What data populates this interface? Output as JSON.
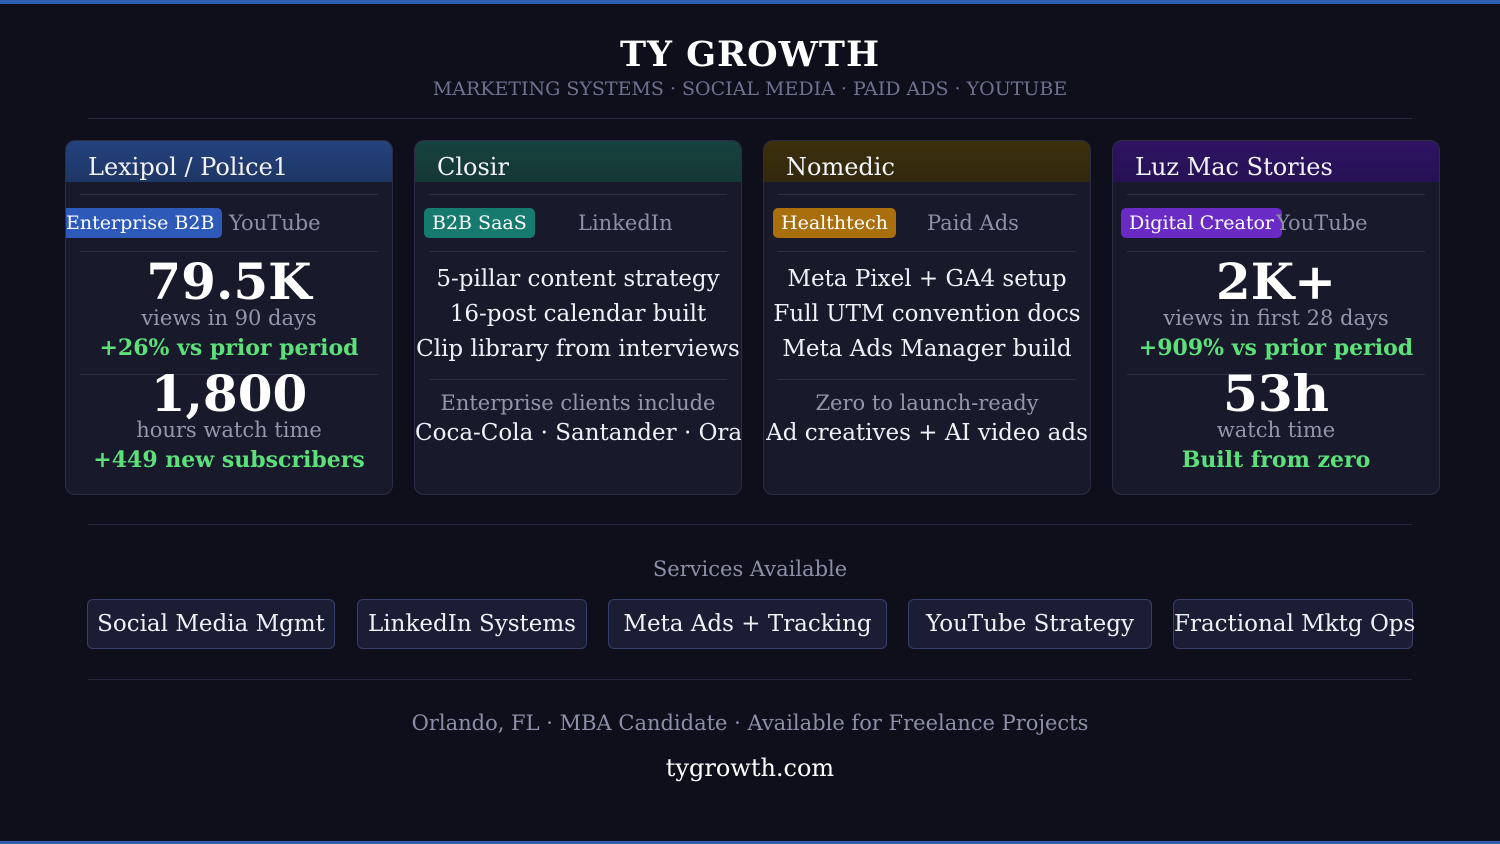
{
  "header": {
    "brand": "TY GROWTH",
    "tagline": "MARKETING SYSTEMS · SOCIAL MEDIA · PAID ADS · YOUTUBE"
  },
  "cards": [
    {
      "client": "Lexipol / Police1",
      "badge": "Enterprise B2B",
      "platform": "YouTube",
      "accent": "#2d5ab8",
      "stat1": "79.5K",
      "stat1_label": "views in 90 days",
      "stat1_growth": "+26% vs prior period",
      "stat2": "1,800",
      "stat2_label": "hours watch time",
      "stat2_growth": "+449 new subscribers"
    },
    {
      "client": "Closir",
      "badge": "B2B SaaS",
      "platform": "LinkedIn",
      "accent": "#167a6e",
      "lines": [
        "5-pillar content strategy",
        "16-post calendar built",
        "Clip library from interviews"
      ],
      "footnote": "Enterprise clients include",
      "highlight": "Coca-Cola · Santander · Orange"
    },
    {
      "client": "Nomedic",
      "badge": "Healthtech",
      "platform": "Paid Ads",
      "accent": "#a86f0c",
      "lines": [
        "Meta Pixel + GA4 setup",
        "Full UTM convention docs",
        "Meta Ads Manager build"
      ],
      "footnote": "Zero to launch-ready",
      "highlight": "Ad creatives + AI video ads"
    },
    {
      "client": "Luz Mac Stories",
      "badge": "Digital Creator",
      "platform": "YouTube",
      "accent": "#6a2bc4",
      "stat1": "2K+",
      "stat1_label": "views in first 28 days",
      "stat1_growth": "+909% vs prior period",
      "stat2": "53h",
      "stat2_label": "watch time",
      "stat2_growth": "Built from zero"
    }
  ],
  "services": {
    "title": "Services Available",
    "items": [
      "Social Media Mgmt",
      "LinkedIn Systems",
      "Meta Ads + Tracking",
      "YouTube Strategy",
      "Fractional Mktg Ops"
    ]
  },
  "footer": {
    "info": "Orlando, FL · MBA Candidate · Available for Freelance Projects",
    "url": "tygrowth.com"
  },
  "colors": {
    "background": "#0f0f1c",
    "card": "#181a2b",
    "growth": "#5ce07a",
    "topbar": "#2f5fae"
  }
}
